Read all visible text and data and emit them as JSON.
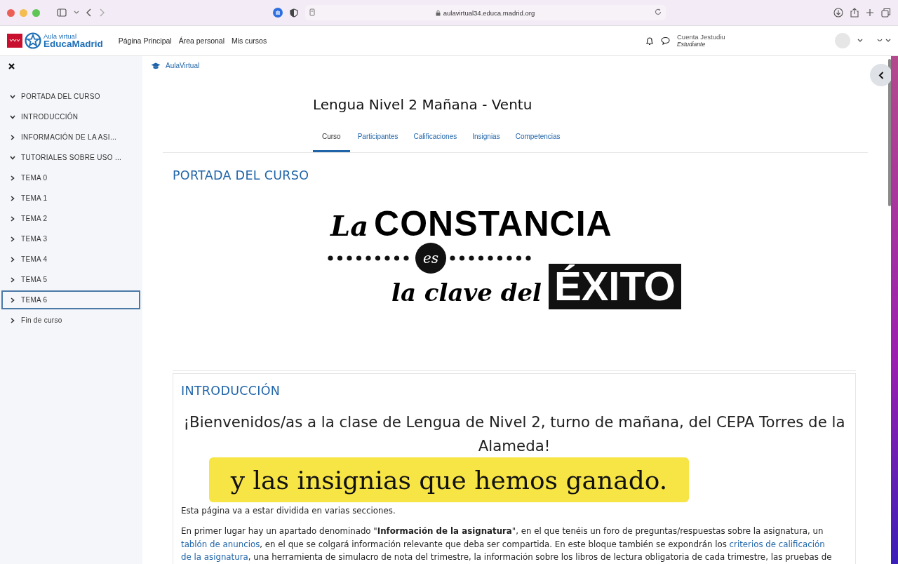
{
  "browser": {
    "url": "aulavirtual34.educa.madrid.org"
  },
  "header": {
    "logo_small": "Aula virtual",
    "logo_name": "EducaMadrid",
    "nav": [
      "Página Principal",
      "Área personal",
      "Mis cursos"
    ],
    "user_name": "Cuenta Jestudiu",
    "user_role": "Estudiante"
  },
  "sidebar": {
    "items": [
      {
        "label": "PORTADA DEL CURSO",
        "expanded": true,
        "selected": false
      },
      {
        "label": "INTRODUCCIÓN",
        "expanded": true,
        "selected": false
      },
      {
        "label": "INFORMACIÓN DE LA ASI...",
        "expanded": false,
        "selected": false
      },
      {
        "label": "TUTORIALES SOBRE USO ...",
        "expanded": true,
        "selected": false
      },
      {
        "label": "TEMA 0",
        "expanded": false,
        "selected": false
      },
      {
        "label": "TEMA 1",
        "expanded": false,
        "selected": false
      },
      {
        "label": "TEMA 2",
        "expanded": false,
        "selected": false
      },
      {
        "label": "TEMA 3",
        "expanded": false,
        "selected": false
      },
      {
        "label": "TEMA 4",
        "expanded": false,
        "selected": false
      },
      {
        "label": "TEMA 5",
        "expanded": false,
        "selected": false
      },
      {
        "label": "TEMA 6",
        "expanded": false,
        "selected": true
      },
      {
        "label": "Fin de curso",
        "expanded": false,
        "selected": false
      }
    ]
  },
  "breadcrumb": "AulaVirtual",
  "course": {
    "title": "Lengua Nivel 2 Mañana - Ventu",
    "tabs": [
      {
        "label": "Curso",
        "selected": true
      },
      {
        "label": "Participantes",
        "selected": false
      },
      {
        "label": "Calificaciones",
        "selected": false
      },
      {
        "label": "Insignias",
        "selected": false
      },
      {
        "label": "Competencias",
        "selected": false
      }
    ]
  },
  "cover": {
    "title": "PORTADA DEL CURSO",
    "banner": {
      "script_word": "La",
      "big_word": "CONSTANCIA",
      "connector": "es",
      "line2": "la clave del",
      "highlight": "ÉXITO"
    }
  },
  "introduction": {
    "title": "INTRODUCCIÓN",
    "welcome": "¡Bienvenidos/as a la clase de Lengua de Nivel 2, turno de mañana, del CEPA Torres de la Alameda!",
    "paragraphs": [
      {
        "parts": [
          {
            "kind": "text",
            "text": "Esta página va a estar dividida en varias secciones."
          }
        ]
      },
      {
        "parts": [
          {
            "kind": "text",
            "text": "En primer lugar hay un apartado denominado \""
          },
          {
            "kind": "bold",
            "text": "Información de la asignatura"
          },
          {
            "kind": "text",
            "text": "\", en el que tenéis un foro de preguntas/respuestas sobre la asignatura, un "
          },
          {
            "kind": "link",
            "text": "tablón de anuncios"
          },
          {
            "kind": "text",
            "text": ", en el que se colgará información relevante que deba ser compartida. En este bloque también se expondrán los "
          },
          {
            "kind": "link",
            "text": "criterios de calificación "
          },
          {
            "kind": "link",
            "text": "de la asignatura"
          },
          {
            "kind": "text",
            "text": ", una herramienta de simulacro de nota del trimestre, la información sobre los libros de lectura obligatoria de cada trimestre, las pruebas de"
          }
        ]
      }
    ]
  },
  "caption": "y las insignias que hemos ganado."
}
